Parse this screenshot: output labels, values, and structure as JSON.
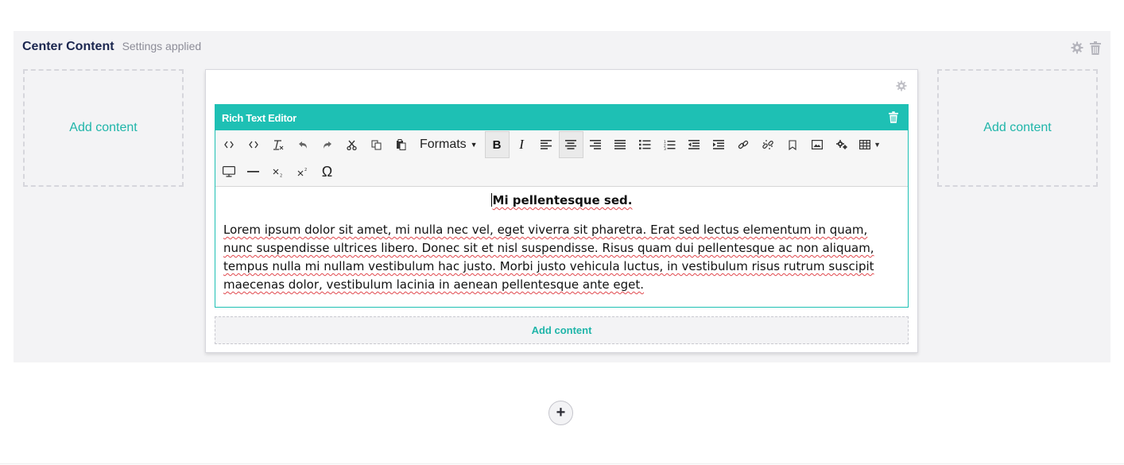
{
  "row": {
    "title": "Center Content",
    "status": "Settings applied"
  },
  "cells": {
    "left_label": "Add content",
    "right_label": "Add content"
  },
  "editor": {
    "title": "Rich Text Editor",
    "toolbar": {
      "formats_label": "Formats",
      "bold_label": "B",
      "italic_label": "I",
      "omega_label": "Ω"
    },
    "content": {
      "heading": "Mi pellentesque sed.",
      "paragraph": "Lorem ipsum dolor sit amet, mi nulla nec vel, eget viverra sit pharetra. Erat sed lectus elementum in quam, nunc suspendisse ultrices libero. Donec sit et nisl suspendisse. Risus quam dui pellentesque ac non aliquam, tempus nulla mi nullam vestibulum hac justo. Morbi justo vehicula luctus, in vestibulum risus rutrum suscipit maecenas dolor, vestibulum lacinia in aenean pellentesque ante eget."
    },
    "add_content_label": "Add content"
  },
  "add_row": {
    "label": "+"
  },
  "colors": {
    "accent": "#1ec0b4",
    "link": "#1fb5a9",
    "title": "#1b264f",
    "panel": "#f3f3f5"
  },
  "icons": [
    "gear-icon",
    "trash-icon",
    "source-code-icon",
    "code-icon",
    "clear-format-icon",
    "undo-icon",
    "redo-icon",
    "cut-icon",
    "copy-icon",
    "paste-icon",
    "align-left-icon",
    "align-center-icon",
    "align-right-icon",
    "align-justify-icon",
    "bullet-list-icon",
    "numbered-list-icon",
    "outdent-icon",
    "indent-icon",
    "link-icon",
    "unlink-icon",
    "anchor-icon",
    "image-icon",
    "macro-icon",
    "table-icon",
    "embed-icon",
    "horizontal-rule-icon",
    "subscript-icon",
    "superscript-icon",
    "special-char-icon",
    "plus-icon"
  ]
}
